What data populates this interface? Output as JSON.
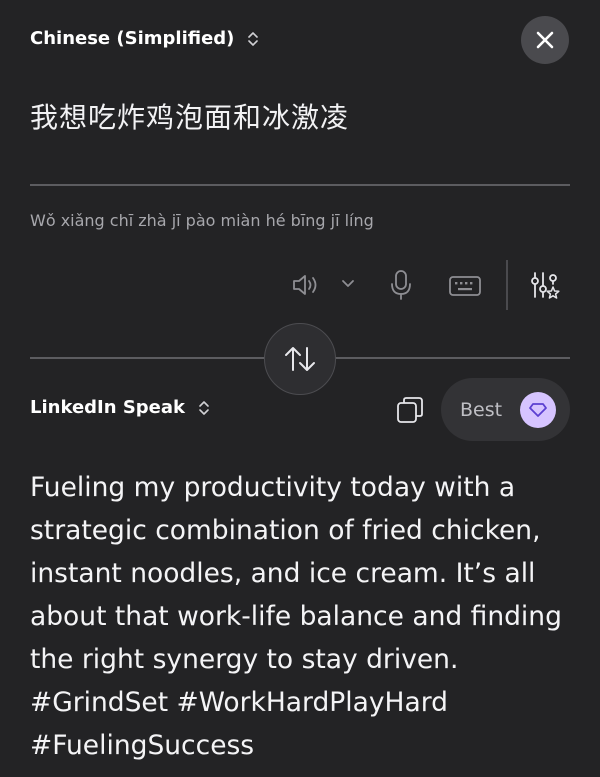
{
  "source": {
    "language": "Chinese (Simplified)",
    "text": "我想吃炸鸡泡面和冰激凌",
    "pinyin": "Wǒ xiǎng chī zhà jī pào miàn hé bīng jī líng"
  },
  "target": {
    "language": "LinkedIn Speak",
    "quality_label": "Best",
    "text": "Fueling my productivity today with a strategic combination of fried chicken, instant noodles, and ice cream. It’s all about that work-life balance and finding the right synergy to stay driven. #GrindSet #WorkHardPlayHard #FuelingSuccess"
  },
  "icons": {
    "close": "close-icon",
    "speaker": "speaker-icon",
    "voice_dropdown": "chevron-down-icon",
    "microphone": "microphone-icon",
    "keyboard": "keyboard-icon",
    "tone_settings": "sliders-sparkle-icon",
    "swap": "swap-arrows-icon",
    "copy": "copy-icon",
    "best_badge": "gem-icon"
  },
  "colors": {
    "background": "#232325",
    "badge": "#d6c4ff",
    "badge_icon": "#5b3fd1"
  }
}
